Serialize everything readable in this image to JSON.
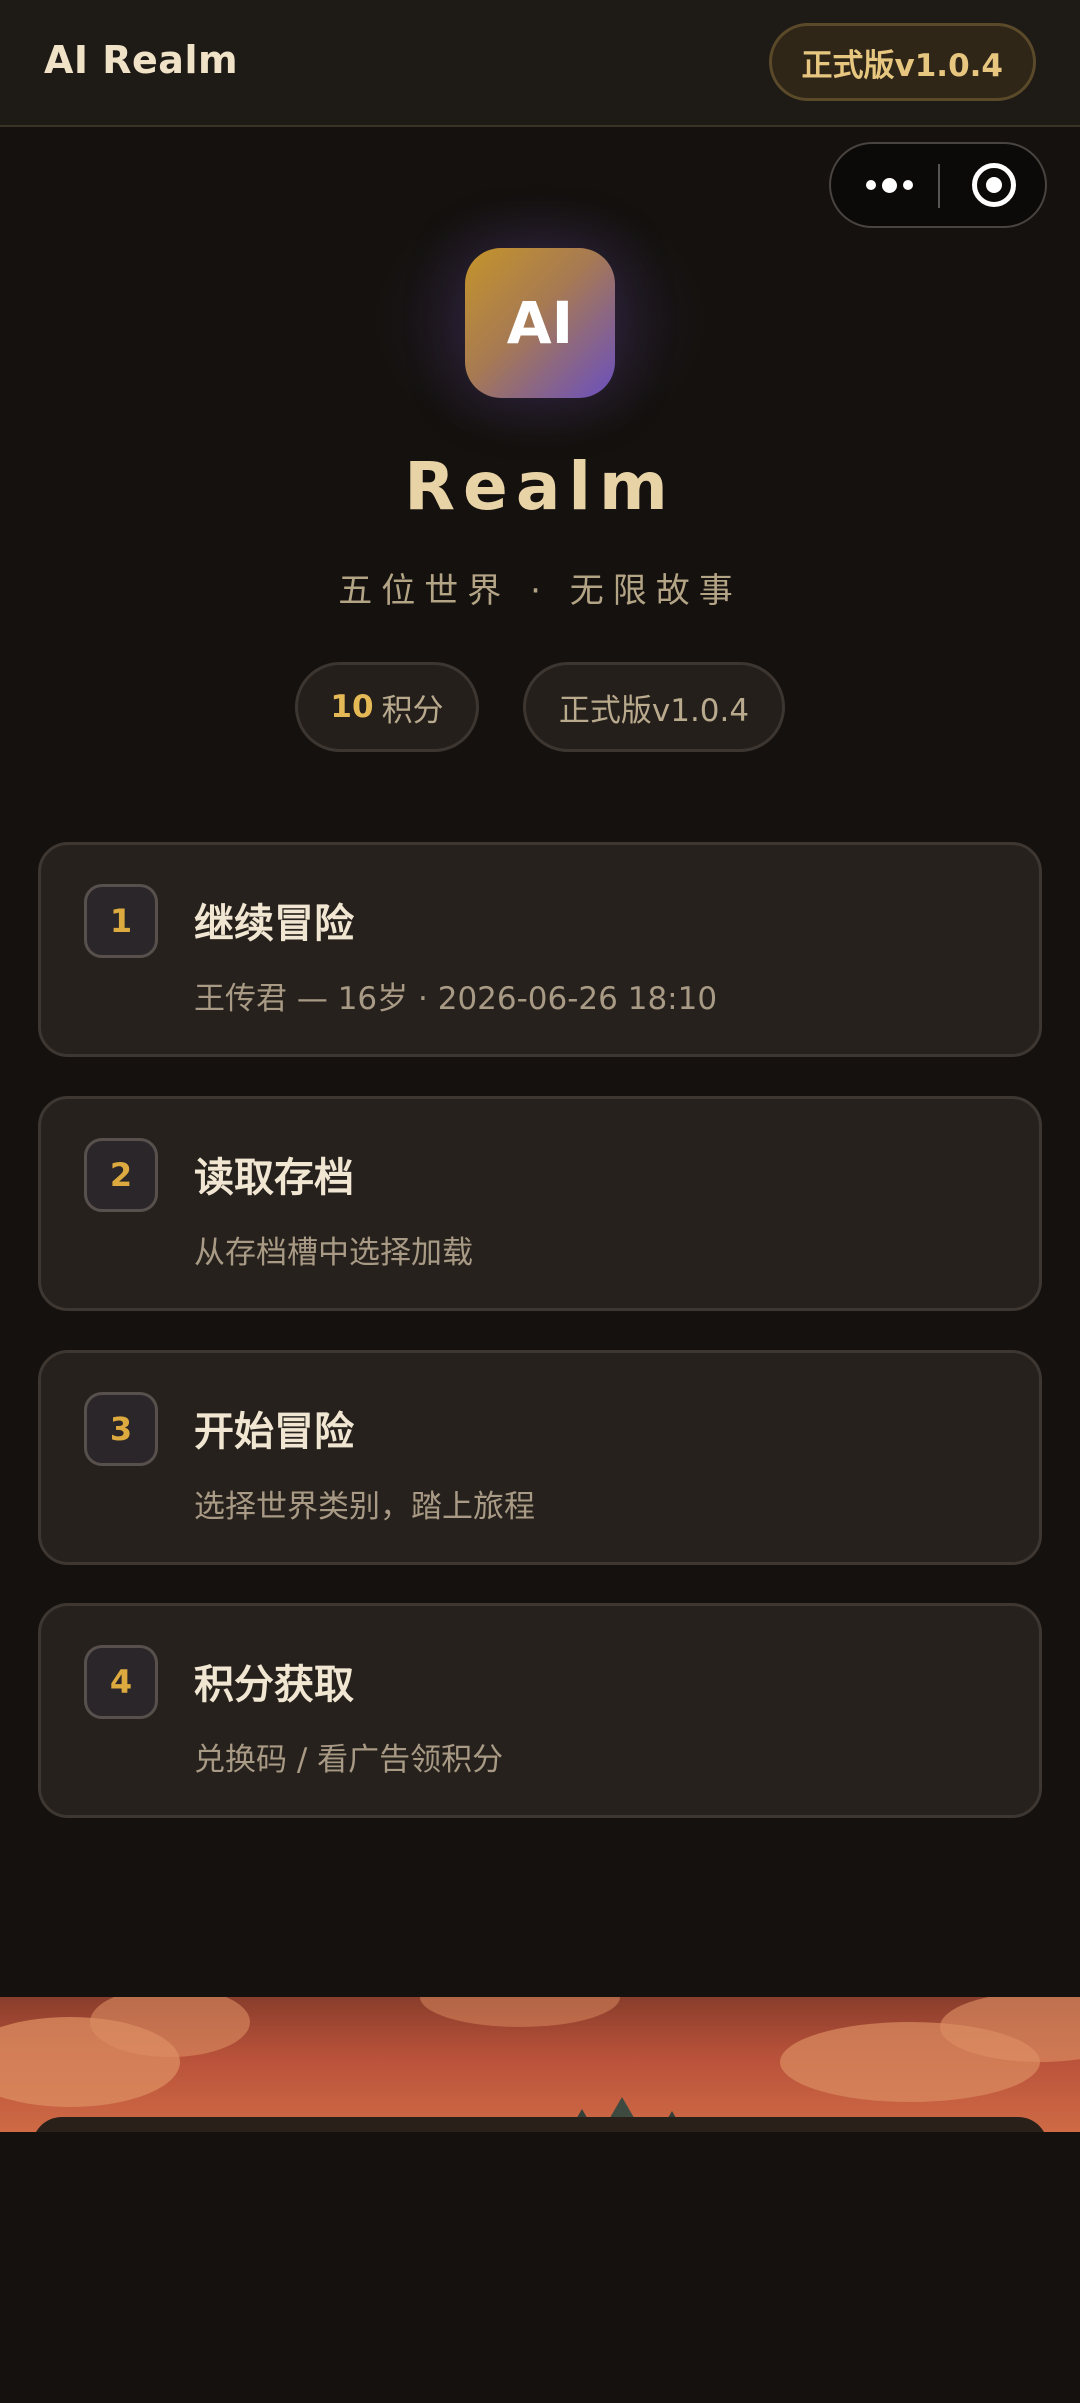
{
  "header": {
    "app_title": "AI Realm",
    "version_chip": "正式版v1.0.4"
  },
  "capsule": {
    "more_icon": "more-dots-icon",
    "close_icon": "target-circle-icon"
  },
  "hero": {
    "logo_text": "AI",
    "brand": "Realm",
    "tagline": "五位世界 · 无限故事",
    "points_value": "10",
    "points_label": "积分",
    "version": "正式版v1.0.4"
  },
  "menu": [
    {
      "index": "1",
      "title": "继续冒险",
      "subtitle": "王传君 — 16岁 · 2026-06-26 18:10"
    },
    {
      "index": "2",
      "title": "读取存档",
      "subtitle": "从存档槽中选择加载"
    },
    {
      "index": "3",
      "title": "开始冒险",
      "subtitle": "选择世界类别，踏上旅程"
    },
    {
      "index": "4",
      "title": "积分获取",
      "subtitle": "兑换码 / 看广告领积分"
    }
  ],
  "colors": {
    "background": "#14110e",
    "accent_gold": "#e5ba56",
    "card_bg": "#26211d"
  }
}
